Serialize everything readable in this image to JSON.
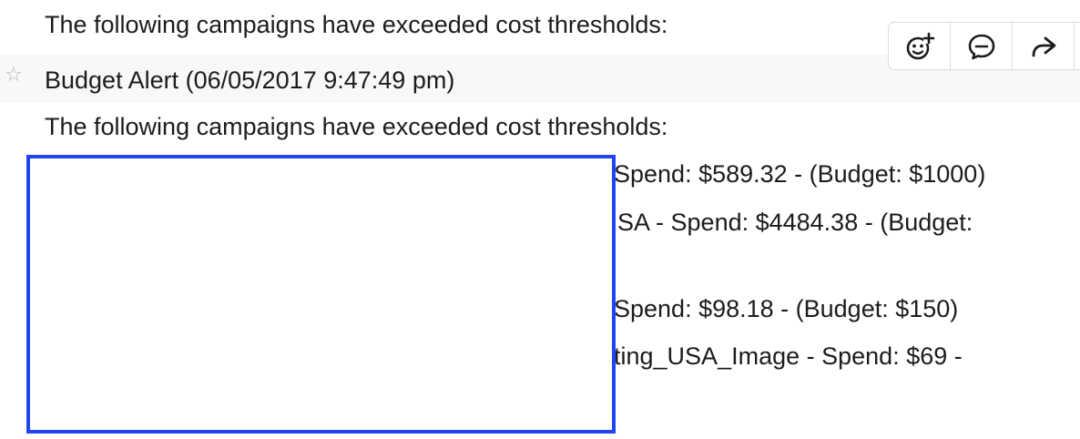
{
  "message_prev": {
    "body_intro": "The following campaigns have exceeded cost thresholds:"
  },
  "message": {
    "title": "Budget Alert (06/05/2017 9:47:49 pm)",
    "body_intro": "The following campaigns have exceeded cost thresholds:",
    "lines": [
      "Spend: $589.32 - (Budget: $1000)",
      "SA - Spend: $4484.38 - (Budget:",
      "Spend: $98.18 - (Budget: $150)",
      "ting_USA_Image - Spend: $69 -"
    ]
  },
  "actions": {
    "icons": [
      "add-reaction-icon",
      "reply-thread-icon",
      "share-forward-icon"
    ]
  },
  "colors": {
    "redaction_border": "#1f45f2",
    "hover_bg": "#f8f8f8",
    "text": "#1d1c1d"
  }
}
